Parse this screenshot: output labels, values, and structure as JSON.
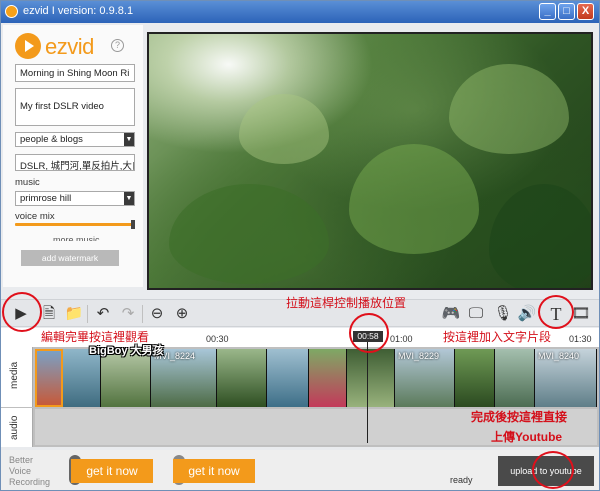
{
  "window": {
    "title": "ezvid I version: 0.9.8.1",
    "minimize_glyph": "_",
    "maximize_glyph": "□",
    "close_glyph": "X"
  },
  "sidebar": {
    "logo_text": "ezvid",
    "help_glyph": "?",
    "title_value": "Morning in Shing Moon Ri",
    "description_value": "My first DSLR video",
    "category_value": "people & blogs",
    "tags_value": "DSLR, 城門河,單反拍片,大自",
    "music_label": "music",
    "music_value": "primrose hill",
    "voice_mix_label": "voice mix",
    "voice_mix_level": 1.0,
    "more_music_label": "more music",
    "watermark_button": "add watermark"
  },
  "toolbar": {
    "play_icon": "play-icon",
    "icons": [
      "play-icon",
      "file-icon",
      "folder-icon",
      "undo-icon",
      "redo-icon",
      "zoom-out-icon",
      "zoom-in-icon",
      "gamepad-icon",
      "monitor-icon",
      "microphone-icon",
      "speaker-icon",
      "text-icon",
      "film-icon"
    ]
  },
  "timeline": {
    "ticks": [
      "00:30",
      "01:00",
      "01:30"
    ],
    "playhead_time": "00:58",
    "track_media": "media",
    "track_audio": "audio",
    "clips": [
      "MVI_8224",
      "MVI_8229",
      "MVI_8240"
    ]
  },
  "bottom": {
    "promo_line1": "Better",
    "promo_line2": "Voice",
    "promo_line3": "Recording",
    "ad1": "get it now",
    "ad2": "get it now",
    "status": "ready",
    "upload_button": "upload to youtube"
  },
  "annotations": {
    "drag_playhead": "拉動這桿控制播放位置",
    "play_hint": "編輯完畢按這裡觀看",
    "author": "BigBoy 大男孩",
    "text_hint": "按這裡加入文字片段",
    "upload_hint_1": "完成後按這裡直接",
    "upload_hint_2": "上傳Youtube"
  },
  "colors": {
    "brand": "#f39a1b",
    "annotation": "#d4101b"
  }
}
